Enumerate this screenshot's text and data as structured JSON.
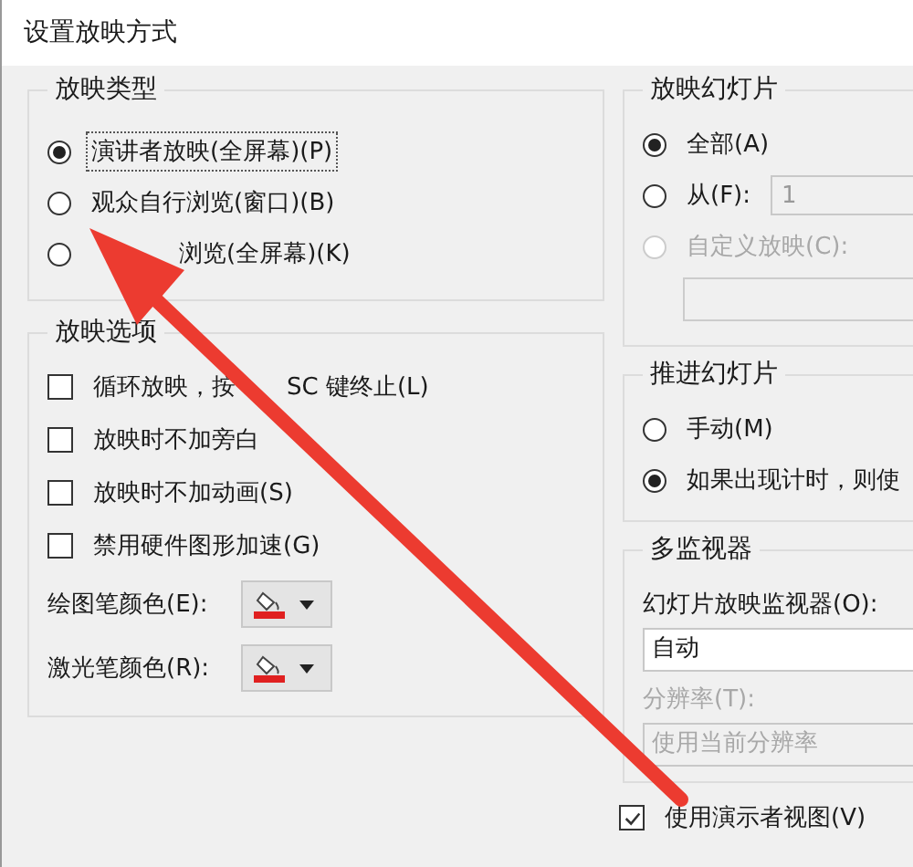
{
  "title": "设置放映方式",
  "show_type": {
    "title": "放映类型",
    "options": [
      {
        "label": "演讲者放映(全屏幕)(P)",
        "selected": true,
        "focused": true
      },
      {
        "label": "观众自行浏览(窗口)(B)",
        "selected": false,
        "focused": false
      },
      {
        "label": "浏览(全屏幕)(K)",
        "selected": false,
        "focused": false,
        "kind": "obscured"
      }
    ]
  },
  "show_options": {
    "title": "放映选项",
    "checkboxes": [
      {
        "label_parts": [
          "循环放映，按",
          "SC 键终止(L)"
        ],
        "checked": false
      },
      {
        "label_parts": [
          "放映时不加旁白"
        ],
        "checked": false
      },
      {
        "label_parts": [
          "放映时不加动画(S)"
        ],
        "checked": false
      },
      {
        "label_parts": [
          "禁用硬件图形加速(G)"
        ],
        "checked": false
      }
    ],
    "pen_colors": [
      {
        "label": "绘图笔颜色(E):",
        "color": "#e02020"
      },
      {
        "label": "激光笔颜色(R):",
        "color": "#e02020"
      }
    ]
  },
  "show_slides": {
    "title": "放映幻灯片",
    "options": [
      {
        "kind": "plain",
        "label": "全部(A)",
        "selected": true,
        "disabled": false
      },
      {
        "kind": "range",
        "label": "从(F):",
        "selected": false,
        "disabled": false,
        "from": "1"
      },
      {
        "kind": "custom",
        "label": "自定义放映(C):",
        "selected": false,
        "disabled": true
      }
    ]
  },
  "advance": {
    "title": "推进幻灯片",
    "options": [
      {
        "label": "手动(M)",
        "selected": false
      },
      {
        "label": "如果出现计时，则使",
        "selected": true
      }
    ]
  },
  "monitors": {
    "title": "多监视器",
    "monitor_label": "幻灯片放映监视器(O):",
    "monitor_value": "自动",
    "resolution_label": "分辨率(T):",
    "resolution_value": "使用当前分辨率",
    "resolution_disabled": true,
    "presenter_view": {
      "label": "使用演示者视图(V)",
      "checked": true
    }
  }
}
